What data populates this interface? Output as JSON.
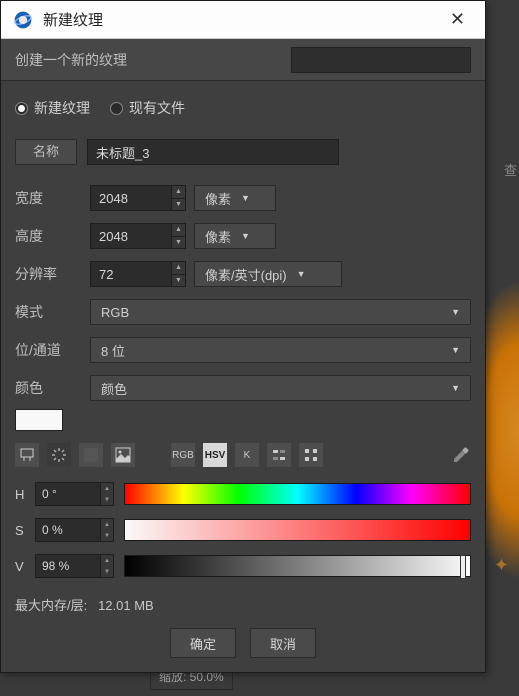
{
  "titlebar": {
    "title": "新建纹理"
  },
  "subtitle": "创建一个新的纹理",
  "radios": {
    "new_label": "新建纹理",
    "existing_label": "现有文件"
  },
  "name": {
    "label": "名称",
    "value": "未标题_3"
  },
  "width": {
    "label": "宽度",
    "value": "2048",
    "unit": "像素"
  },
  "height": {
    "label": "高度",
    "value": "2048",
    "unit": "像素"
  },
  "resolution": {
    "label": "分辨率",
    "value": "72",
    "unit": "像素/英寸(dpi)"
  },
  "mode": {
    "label": "模式",
    "value": "RGB"
  },
  "bits": {
    "label": "位/通道",
    "value": "8 位"
  },
  "color": {
    "label": "颜色",
    "value": "颜色"
  },
  "icons": {
    "rgb": "RGB",
    "hsv": "HSV",
    "k": "K"
  },
  "hsv": {
    "h": {
      "label": "H",
      "value": "0 °"
    },
    "s": {
      "label": "S",
      "value": "0 %"
    },
    "v": {
      "label": "V",
      "value": "98 %"
    }
  },
  "memory": {
    "label": "最大内存/层:",
    "value": "12.01 MB"
  },
  "buttons": {
    "ok": "确定",
    "cancel": "取消"
  },
  "footer_fragment": "缩放: 50.0%",
  "side_char": "查"
}
